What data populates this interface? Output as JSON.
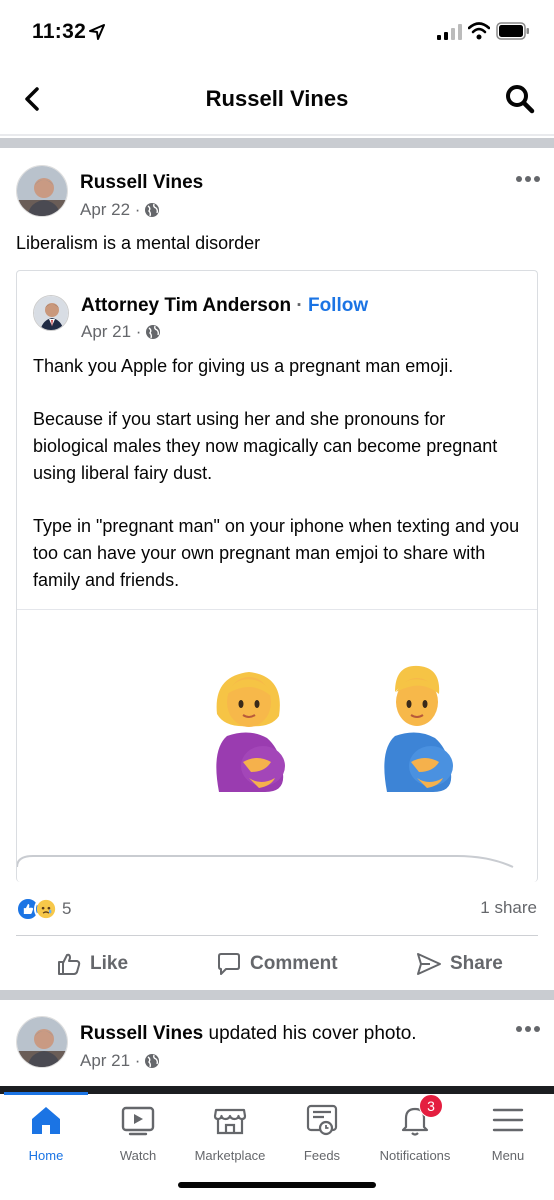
{
  "status": {
    "time": "11:32"
  },
  "header": {
    "title": "Russell Vines"
  },
  "post": {
    "author": "Russell Vines",
    "date": "Apr 22 ·",
    "text": "Liberalism is a mental disorder",
    "shared": {
      "author": "Attorney Tim Anderson",
      "separator": " · ",
      "follow": "Follow",
      "date": "Apr 21 ·",
      "paragraphs": [
        "Thank you Apple for giving us a pregnant man emoji.",
        "Because if you start using her and she pronouns for biological males they now magically can become pregnant using liberal fairy dust.",
        "Type in \"pregnant man\" on your iphone when texting and you too can have your own pregnant man emjoi to share with family and friends."
      ]
    },
    "reaction_count": "5",
    "share_count": "1 share",
    "actions": {
      "like": "Like",
      "comment": "Comment",
      "share": "Share"
    }
  },
  "second_post": {
    "author": "Russell Vines",
    "action": " updated his cover photo.",
    "date": "Apr 21 ·"
  },
  "tabs": [
    {
      "label": "Home",
      "icon": "home-icon"
    },
    {
      "label": "Watch",
      "icon": "watch-icon"
    },
    {
      "label": "Marketplace",
      "icon": "marketplace-icon"
    },
    {
      "label": "Feeds",
      "icon": "feeds-icon"
    },
    {
      "label": "Notifications",
      "icon": "bell-icon",
      "badge": "3"
    },
    {
      "label": "Menu",
      "icon": "menu-icon"
    }
  ],
  "colors": {
    "brand_blue": "#1b74e4",
    "badge_red": "#e41e3f",
    "muted": "#65676b"
  }
}
